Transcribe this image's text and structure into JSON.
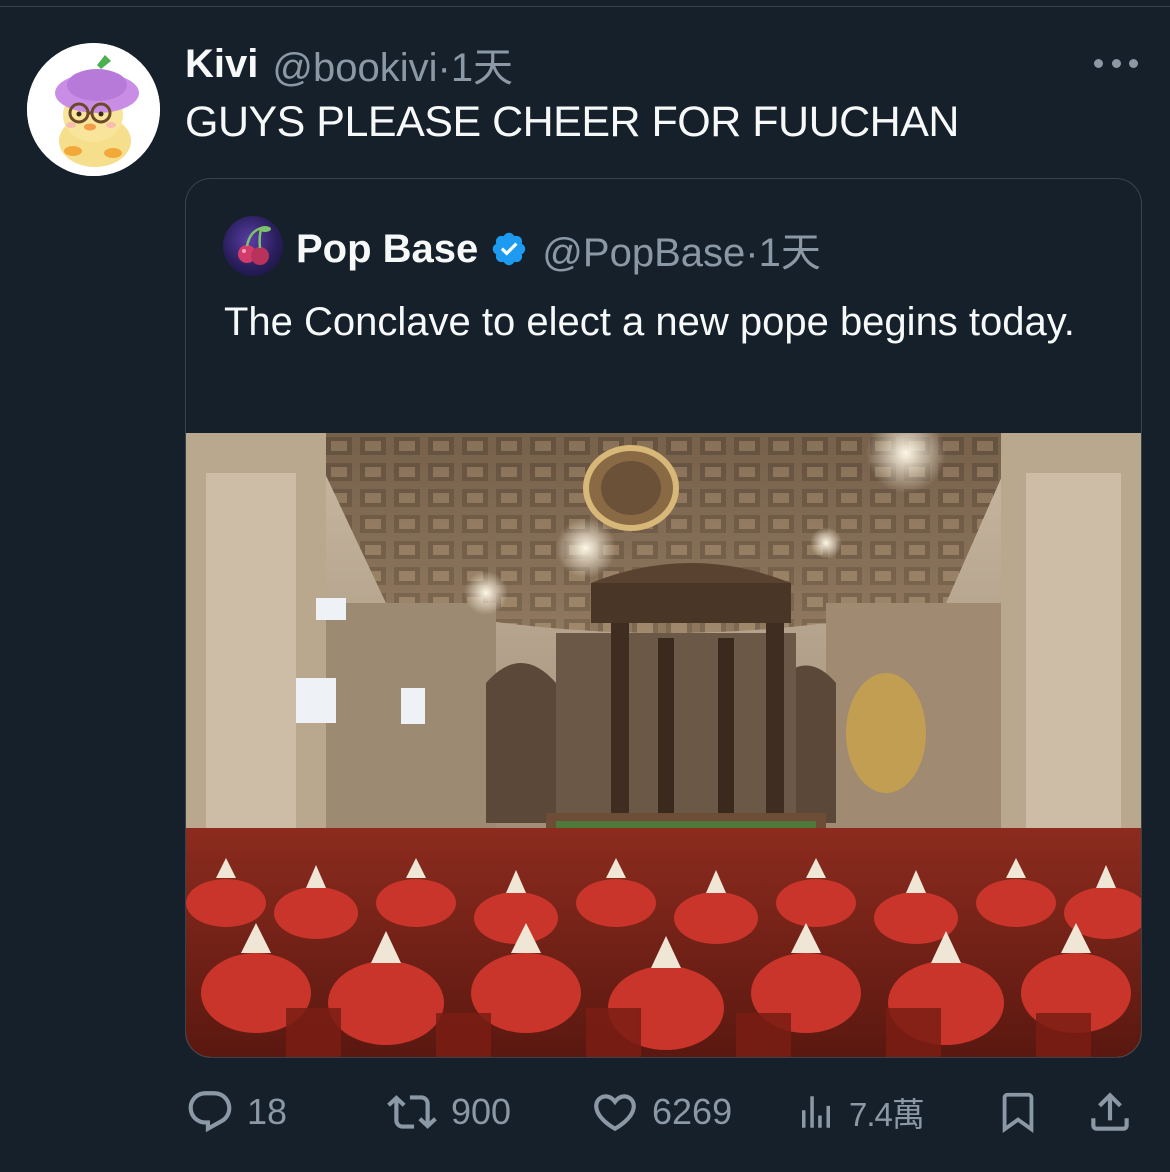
{
  "tweet": {
    "author_name": "Kivi",
    "author_handle": "@bookivi",
    "separator": "·",
    "time": "1天",
    "text": "GUYS PLEASE CHEER FOR FUUCHAN",
    "more_icon": "more-dots-icon"
  },
  "quote": {
    "author_name": "Pop Base",
    "verified": true,
    "verified_color": "#1d9bf0",
    "author_handle": "@PopBase",
    "separator": "·",
    "time": "1天",
    "text": "The Conclave to elect a new pope begins today."
  },
  "actions": {
    "reply": {
      "icon": "reply-icon",
      "count": "18"
    },
    "retweet": {
      "icon": "retweet-icon",
      "count": "900"
    },
    "like": {
      "icon": "heart-icon",
      "count": "6269"
    },
    "views": {
      "icon": "views-icon",
      "count": "7.4萬"
    },
    "bookmark": {
      "icon": "bookmark-icon"
    },
    "share": {
      "icon": "share-icon"
    }
  },
  "colors": {
    "background": "#15202b",
    "text": "#f7f9f9",
    "secondary": "#8b98a5",
    "border": "#38444d"
  }
}
